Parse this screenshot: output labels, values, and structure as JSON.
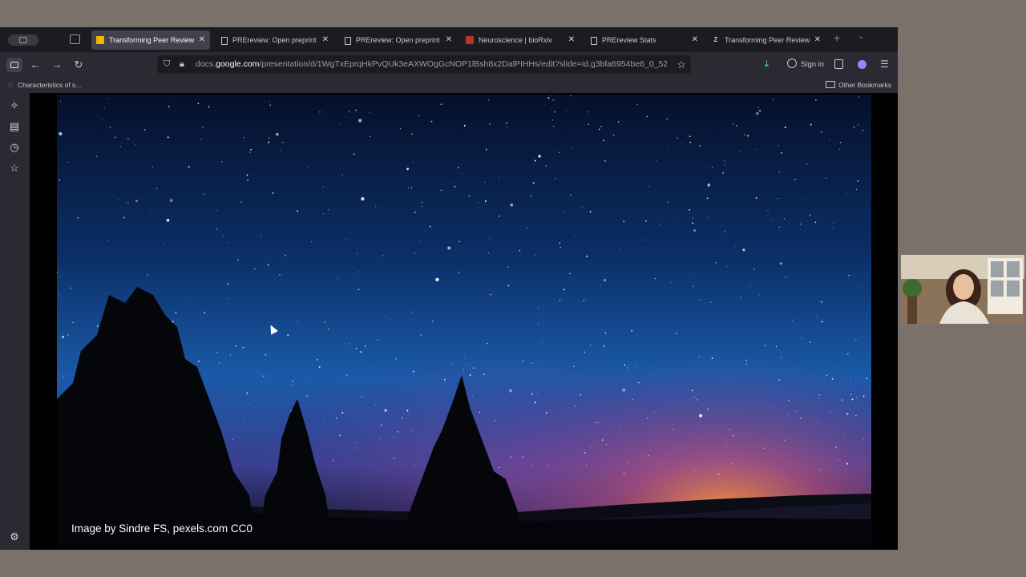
{
  "browser": {
    "tabs": [
      {
        "title": "Transforming Peer Review w",
        "favicon": "slides-icon",
        "color": "#f4b400",
        "active": true
      },
      {
        "title": "PREreview: Open preprint re",
        "favicon": "page-icon",
        "color": "#c9c8cf",
        "active": false
      },
      {
        "title": "PREreview: Open preprint re",
        "favicon": "page-icon",
        "color": "#c9c8cf",
        "active": false
      },
      {
        "title": "Neuroscience | bioRxiv",
        "favicon": "biorxiv-icon",
        "color": "#b03a2e",
        "active": false
      },
      {
        "title": "PREreview Stats",
        "favicon": "page-icon",
        "color": "#c9c8cf",
        "active": false
      },
      {
        "title": "Transforming Peer Review w",
        "favicon": "zenodo-icon",
        "color": "#c9c8cf",
        "active": false
      }
    ],
    "url_prefix": "docs.",
    "url_domain": "google.com",
    "url_path": "/presentation/d/1WgTxEprqHkPvQUk3eAXWOgGcNOP1lBsh8x2DalPIHHs/edit?slide=id.g3bfa6954be6_0_52",
    "signin_label": "Sign in",
    "bookmark_item": "Characteristics of s...",
    "other_bookmarks": "Other Bookmarks"
  },
  "slide": {
    "caption": "Image by Sindre FS, pexels.com CC0"
  },
  "colors": {
    "accent_download": "#54ffbd",
    "profile": "#8f8bff"
  }
}
